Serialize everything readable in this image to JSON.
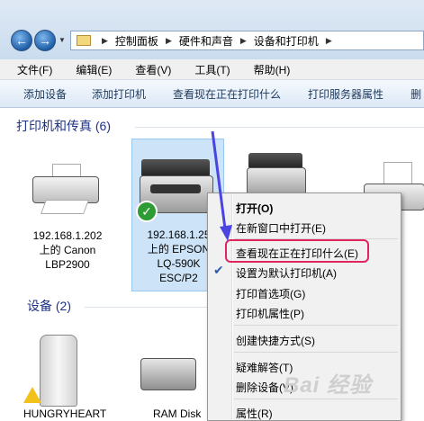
{
  "address": {
    "crumbs": [
      "控制面板",
      "硬件和声音",
      "设备和打印机"
    ]
  },
  "menu": [
    "文件(F)",
    "编辑(E)",
    "查看(V)",
    "工具(T)",
    "帮助(H)"
  ],
  "commands": [
    "添加设备",
    "添加打印机",
    "查看现在正在打印什么",
    "打印服务器属性",
    "删"
  ],
  "printers_group": {
    "title": "打印机和传真 (6)",
    "items": [
      {
        "line1": "192.168.1.202",
        "line2": "上的 Canon",
        "line3": "LBP2900"
      },
      {
        "line1": "192.168.1.25",
        "line2": "上的 EPSON",
        "line3": "LQ-590K",
        "line4": "ESC/P2"
      }
    ]
  },
  "devices_group": {
    "title": "设备 (2)",
    "items": [
      {
        "label": "HUNGRYHEART"
      },
      {
        "label": "RAM Disk"
      }
    ]
  },
  "context_menu": {
    "items": [
      "打开(O)",
      "在新窗口中打开(E)",
      "查看现在正在打印什么(E)",
      "设置为默认打印机(A)",
      "打印首选项(G)",
      "打印机属性(P)",
      "创建快捷方式(S)",
      "疑难解答(T)",
      "删除设备(V)",
      "属性(R)"
    ],
    "highlighted_index": 2,
    "checked_index": 3
  },
  "colors": {
    "highlight_border": "#e0245e",
    "arrow": "#4a44e0",
    "group_title": "#1e3287"
  },
  "watermark": "Bai 经验"
}
